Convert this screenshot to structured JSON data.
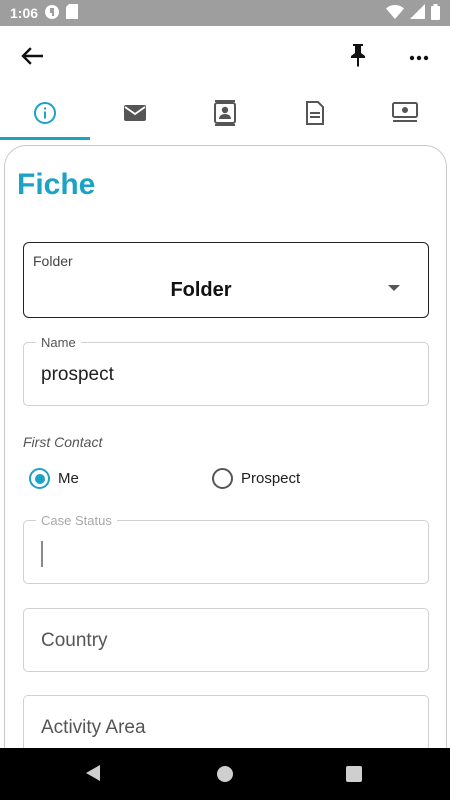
{
  "status_bar": {
    "time": "1:06",
    "left_icons": [
      "circle-app-icon",
      "sd-card-icon"
    ],
    "right_icons": [
      "wifi-icon",
      "signal-icon",
      "battery-icon"
    ]
  },
  "app_bar": {
    "icons": [
      "back-arrow-icon",
      "pin-icon",
      "more-horizontal-icon"
    ]
  },
  "tabs": [
    {
      "icon": "info-icon",
      "active": true
    },
    {
      "icon": "mail-icon",
      "active": false
    },
    {
      "icon": "contact-card-icon",
      "active": false
    },
    {
      "icon": "document-icon",
      "active": false
    },
    {
      "icon": "money-icon",
      "active": false
    }
  ],
  "colors": {
    "accent": "#1aa3c4",
    "status_bar": "#9e9e9e",
    "nav_bar": "#000000"
  },
  "form": {
    "title": "Fiche",
    "folder": {
      "label": "Folder",
      "value": "Folder"
    },
    "name": {
      "label": "Name",
      "value": "prospect"
    },
    "first_contact": {
      "label": "First Contact",
      "options": [
        {
          "label": "Me",
          "checked": true
        },
        {
          "label": "Prospect",
          "checked": false
        }
      ]
    },
    "case_status": {
      "label": "Case Status",
      "value": ""
    },
    "country": {
      "placeholder": "Country"
    },
    "activity_area": {
      "placeholder": "Activity Area"
    }
  },
  "nav_bar": {
    "icons": [
      "nav-back-icon",
      "nav-home-icon",
      "nav-recents-icon"
    ]
  }
}
